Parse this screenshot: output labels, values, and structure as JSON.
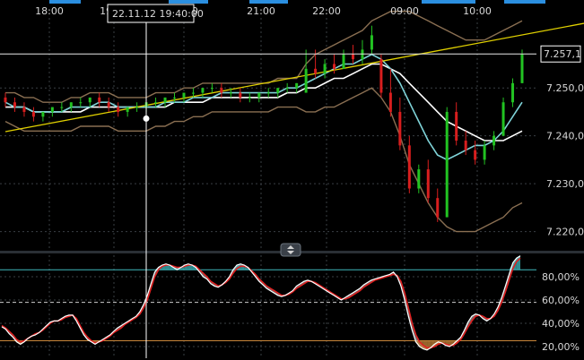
{
  "chart_data": [
    {
      "type": "candlestick",
      "panel": "price",
      "x_tick_labels": [
        "18:00",
        "19:00",
        "20:00",
        "21:00",
        "22:00",
        "09:00",
        "10:00"
      ],
      "y_tick_labels": [
        "7.250,0",
        "7.240,0",
        "7.230,0",
        "7.220,0"
      ],
      "ylim": [
        7216,
        7265
      ],
      "last_price_label": "7.257,1",
      "last_price": 7257.1,
      "crosshair_time_label": "22.11.12 19:40:00",
      "ohlc": [
        [
          7248,
          7249,
          7246,
          7247
        ],
        [
          7247,
          7248,
          7245,
          7246
        ],
        [
          7246,
          7247,
          7244,
          7245
        ],
        [
          7245,
          7246,
          7243,
          7244
        ],
        [
          7244,
          7245,
          7243,
          7245
        ],
        [
          7245,
          7246,
          7244,
          7246
        ],
        [
          7246,
          7247,
          7245,
          7246
        ],
        [
          7246,
          7247,
          7245,
          7247
        ],
        [
          7247,
          7248,
          7246,
          7247
        ],
        [
          7247,
          7248,
          7246,
          7248
        ],
        [
          7248,
          7249,
          7246,
          7247
        ],
        [
          7247,
          7248,
          7245,
          7246
        ],
        [
          7246,
          7247,
          7244,
          7245
        ],
        [
          7245,
          7246,
          7244,
          7246
        ],
        [
          7246,
          7247,
          7245,
          7246
        ],
        [
          7246,
          7247,
          7245,
          7247
        ],
        [
          7247,
          7248,
          7246,
          7247
        ],
        [
          7247,
          7248,
          7246,
          7248
        ],
        [
          7248,
          7249,
          7247,
          7248
        ],
        [
          7248,
          7249,
          7247,
          7249
        ],
        [
          7249,
          7250,
          7248,
          7249
        ],
        [
          7249,
          7250,
          7248,
          7250
        ],
        [
          7250,
          7251,
          7249,
          7250
        ],
        [
          7250,
          7251,
          7248,
          7249
        ],
        [
          7249,
          7250,
          7248,
          7249
        ],
        [
          7249,
          7250,
          7247,
          7248
        ],
        [
          7248,
          7249,
          7247,
          7248
        ],
        [
          7248,
          7249,
          7247,
          7249
        ],
        [
          7249,
          7250,
          7248,
          7249
        ],
        [
          7249,
          7250,
          7248,
          7250
        ],
        [
          7250,
          7251,
          7249,
          7250
        ],
        [
          7250,
          7251,
          7249,
          7251
        ],
        [
          7249,
          7258,
          7249,
          7254
        ],
        [
          7254,
          7258,
          7252,
          7253
        ],
        [
          7253,
          7256,
          7252,
          7255
        ],
        [
          7255,
          7257,
          7253,
          7254
        ],
        [
          7254,
          7258,
          7254,
          7257
        ],
        [
          7257,
          7259,
          7255,
          7256
        ],
        [
          7256,
          7260,
          7255,
          7258
        ],
        [
          7258,
          7263,
          7257,
          7261
        ],
        [
          7256,
          7257,
          7248,
          7249
        ],
        [
          7249,
          7254,
          7244,
          7245
        ],
        [
          7245,
          7248,
          7237,
          7238
        ],
        [
          7238,
          7240,
          7228,
          7229
        ],
        [
          7229,
          7234,
          7228,
          7233
        ],
        [
          7233,
          7235,
          7226,
          7227
        ],
        [
          7227,
          7229,
          7222,
          7223
        ],
        [
          7223,
          7246,
          7223,
          7245
        ],
        [
          7245,
          7247,
          7238,
          7239
        ],
        [
          7239,
          7241,
          7236,
          7237
        ],
        [
          7237,
          7239,
          7234,
          7235
        ],
        [
          7235,
          7239,
          7234,
          7238
        ],
        [
          7238,
          7241,
          7237,
          7240
        ],
        [
          7240,
          7248,
          7240,
          7247
        ],
        [
          7247,
          7252,
          7246,
          7251
        ],
        [
          7251,
          7258,
          7251,
          7257
        ]
      ],
      "indicators": {
        "bollinger_upper": [
          7249,
          7249,
          7248,
          7248,
          7247,
          7247,
          7247,
          7248,
          7248,
          7249,
          7249,
          7249,
          7248,
          7248,
          7248,
          7248,
          7249,
          7249,
          7249,
          7250,
          7250,
          7251,
          7251,
          7251,
          7251,
          7251,
          7251,
          7251,
          7251,
          7252,
          7252,
          7252,
          7255,
          7257,
          7258,
          7259,
          7260,
          7261,
          7262,
          7264,
          7265,
          7266,
          7266,
          7266,
          7265,
          7264,
          7263,
          7262,
          7261,
          7260,
          7260,
          7260,
          7261,
          7262,
          7263,
          7264
        ],
        "bollinger_lower": [
          7243,
          7242,
          7241,
          7241,
          7241,
          7241,
          7241,
          7241,
          7242,
          7242,
          7242,
          7242,
          7241,
          7241,
          7241,
          7241,
          7242,
          7242,
          7243,
          7243,
          7244,
          7244,
          7245,
          7245,
          7245,
          7245,
          7245,
          7245,
          7245,
          7246,
          7246,
          7246,
          7245,
          7245,
          7246,
          7246,
          7247,
          7248,
          7249,
          7250,
          7248,
          7245,
          7240,
          7234,
          7230,
          7226,
          7223,
          7221,
          7220,
          7220,
          7220,
          7221,
          7222,
          7223,
          7225,
          7226
        ],
        "moving_average_fast": [
          7247,
          7246,
          7246,
          7245,
          7245,
          7245,
          7245,
          7246,
          7246,
          7246,
          7247,
          7247,
          7246,
          7246,
          7246,
          7246,
          7246,
          7247,
          7247,
          7247,
          7248,
          7248,
          7248,
          7249,
          7249,
          7249,
          7249,
          7249,
          7249,
          7249,
          7250,
          7250,
          7251,
          7252,
          7253,
          7254,
          7255,
          7255,
          7256,
          7257,
          7256,
          7254,
          7251,
          7247,
          7243,
          7239,
          7236,
          7235,
          7236,
          7237,
          7238,
          7238,
          7239,
          7241,
          7244,
          7247
        ],
        "moving_average_slow": [
          7246,
          7246,
          7246,
          7245,
          7245,
          7245,
          7245,
          7245,
          7245,
          7246,
          7246,
          7246,
          7246,
          7246,
          7246,
          7246,
          7246,
          7246,
          7247,
          7247,
          7247,
          7247,
          7248,
          7248,
          7248,
          7248,
          7248,
          7248,
          7248,
          7248,
          7249,
          7249,
          7250,
          7250,
          7251,
          7252,
          7252,
          7253,
          7254,
          7255,
          7255,
          7254,
          7253,
          7251,
          7249,
          7247,
          7245,
          7243,
          7242,
          7241,
          7240,
          7239,
          7239,
          7239,
          7240,
          7241
        ],
        "trendline": {
          "start": [
            0,
            7242
          ],
          "end": [
            55,
            7262
          ]
        }
      }
    },
    {
      "type": "line",
      "panel": "oscillator",
      "y_tick_labels": [
        "80,00%",
        "60,00%",
        "40,00%",
        "20,00%"
      ],
      "ylim": [
        10,
        100
      ],
      "levels": {
        "upper": 86,
        "middle": 58,
        "lower": 25
      },
      "series": [
        {
          "values": [
            37,
            35,
            31,
            28,
            24,
            22,
            24,
            27,
            29,
            30,
            32,
            35,
            38,
            41,
            42,
            42,
            44,
            46,
            47,
            47,
            42,
            36,
            30,
            26,
            24,
            22,
            24,
            26,
            28,
            30,
            33,
            36,
            38,
            40,
            42,
            44,
            46,
            50,
            56,
            64,
            74,
            84,
            88,
            90,
            91,
            90,
            88,
            86,
            88,
            90,
            91,
            90,
            88,
            84,
            80,
            78,
            74,
            72,
            71,
            73,
            76,
            80,
            86,
            90,
            91,
            90,
            88,
            84,
            80,
            76,
            73,
            70,
            68,
            66,
            64,
            63,
            64,
            66,
            68,
            72,
            74,
            76,
            77,
            76,
            74,
            72,
            70,
            68,
            66,
            64,
            62,
            60,
            62,
            64,
            66,
            68,
            70,
            73,
            75,
            77,
            78,
            79,
            80,
            81,
            82,
            84,
            80,
            72,
            60,
            46,
            34,
            24,
            20,
            18,
            17,
            19,
            22,
            24,
            23,
            21,
            20,
            22,
            25,
            28,
            34,
            41,
            46,
            48,
            47,
            44,
            42,
            44,
            48,
            54,
            62,
            72,
            82,
            92,
            96,
            98
          ]
        },
        {
          "values": [
            38,
            36,
            33,
            30,
            26,
            24,
            25,
            27,
            29,
            31,
            32,
            34,
            37,
            40,
            42,
            42,
            43,
            45,
            46,
            47,
            44,
            38,
            32,
            28,
            25,
            23,
            24,
            25,
            27,
            29,
            32,
            34,
            36,
            39,
            41,
            43,
            45,
            48,
            53,
            60,
            70,
            80,
            86,
            89,
            90,
            90,
            89,
            88,
            88,
            89,
            90,
            90,
            89,
            86,
            83,
            80,
            76,
            74,
            72,
            73,
            75,
            78,
            83,
            87,
            89,
            89,
            88,
            85,
            82,
            78,
            75,
            72,
            70,
            68,
            66,
            64,
            64,
            65,
            67,
            70,
            72,
            74,
            76,
            76,
            75,
            73,
            71,
            69,
            67,
            65,
            63,
            61,
            61,
            62,
            64,
            66,
            68,
            71,
            73,
            75,
            77,
            78,
            79,
            80,
            81,
            82,
            81,
            76,
            66,
            53,
            40,
            30,
            24,
            21,
            19,
            19,
            20,
            22,
            23,
            22,
            21,
            21,
            23,
            26,
            31,
            37,
            42,
            46,
            47,
            46,
            44,
            44,
            46,
            51,
            58,
            67,
            77,
            87,
            93,
            96
          ]
        }
      ]
    }
  ],
  "ui": {
    "panel_collapse_icon": "up-down-arrows-icon",
    "accent_colors": {
      "trendline": "#e0d000",
      "bollinger": "#8a6f52",
      "ma_fast": "#7fd3d8",
      "ma_slow": "#ffffff",
      "up": "#22c322",
      "down": "#d81e1e",
      "osc_upper": "#3fb9bd",
      "osc_lower": "#c8863a"
    }
  }
}
